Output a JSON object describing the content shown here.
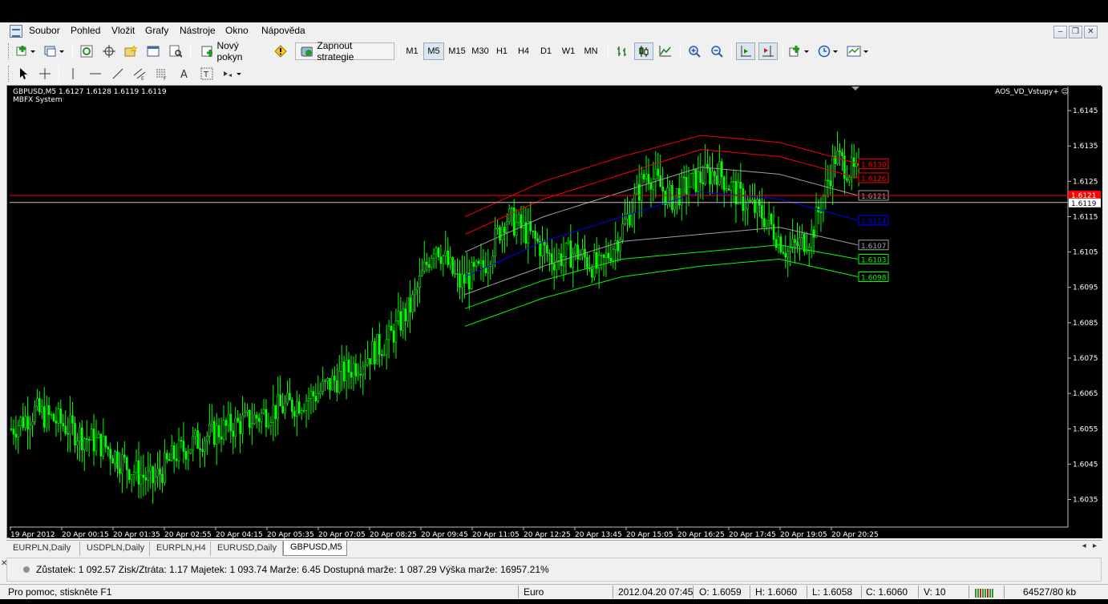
{
  "menu": [
    "Soubor",
    "Pohled",
    "Vložit",
    "Grafy",
    "Nástroje",
    "Okno",
    "Nápověda"
  ],
  "toolbar": {
    "new_order_label": "Nový pokyn",
    "strategy_label": "Zapnout strategie",
    "timeframes": [
      "M1",
      "M5",
      "M15",
      "M30",
      "H1",
      "H4",
      "D1",
      "W1",
      "MN"
    ],
    "active_timeframe": "M5"
  },
  "chart": {
    "symbol_info": "GBPUSD,M5  1.6127 1.6128 1.6119 1.6119",
    "indicator_name": "MBFX System",
    "expert_label": "AOS_VD_Vstupy+ ☺",
    "bid_label": "1.6119",
    "ask_label": "1.6121",
    "level_labels": [
      "1.6130",
      "1.6126",
      "1.6121",
      "1.6114",
      "1.6107",
      "1.6103",
      "1.6098"
    ],
    "colors": {
      "background": "#000000",
      "candles": "#00ff00",
      "upper_band": "#ff0000",
      "mid_band": "#0000ff",
      "neutral_band": "#a0a0a0",
      "lower_band": "#00ff00"
    }
  },
  "chart_data": {
    "type": "line",
    "title": "GBPUSD,M5",
    "xlabel": "",
    "ylabel": "",
    "y_ticks": [
      "1.6145",
      "1.6135",
      "1.6125",
      "1.6115",
      "1.6105",
      "1.6095",
      "1.6085",
      "1.6075",
      "1.6065",
      "1.6055",
      "1.6045",
      "1.6035"
    ],
    "ylim": [
      1.6029,
      1.615
    ],
    "x_ticks": [
      "19 Apr 2012",
      "20 Apr 00:15",
      "20 Apr 01:35",
      "20 Apr 02:55",
      "20 Apr 04:15",
      "20 Apr 05:35",
      "20 Apr 07:05",
      "20 Apr 08:25",
      "20 Apr 09:45",
      "20 Apr 11:05",
      "20 Apr 12:25",
      "20 Apr 13:45",
      "20 Apr 15:05",
      "20 Apr 16:25",
      "20 Apr 17:45",
      "20 Apr 19:05",
      "20 Apr 20:25"
    ],
    "series": [
      {
        "name": "GBPUSD",
        "values": [
          1.6055,
          1.606,
          1.6057,
          1.6053,
          1.605,
          1.6044,
          1.604,
          1.6048,
          1.6052,
          1.6055,
          1.6057,
          1.606,
          1.6062,
          1.6065,
          1.607,
          1.6075,
          1.608,
          1.609,
          1.6108,
          1.6096,
          1.61,
          1.6115,
          1.611,
          1.6103,
          1.6105,
          1.61,
          1.6112,
          1.6128,
          1.612,
          1.6125,
          1.6128,
          1.612,
          1.6115,
          1.6105,
          1.611,
          1.6132,
          1.6126
        ]
      }
    ],
    "bands": [
      {
        "label": "1.6130",
        "values": [
          1.6115,
          1.6125,
          1.6132,
          1.6138,
          1.6136,
          1.613
        ]
      },
      {
        "label": "1.6126",
        "values": [
          1.611,
          1.612,
          1.6127,
          1.6134,
          1.6132,
          1.6126
        ]
      },
      {
        "label": "1.6121",
        "values": [
          1.6105,
          1.6115,
          1.6122,
          1.6129,
          1.6127,
          1.6121
        ]
      },
      {
        "label": "1.6114",
        "values": [
          1.6098,
          1.6108,
          1.6115,
          1.6122,
          1.612,
          1.6114
        ]
      },
      {
        "label": "1.6107",
        "values": [
          1.6093,
          1.6101,
          1.6108,
          1.611,
          1.6112,
          1.6107
        ]
      },
      {
        "label": "1.6103",
        "values": [
          1.6089,
          1.6097,
          1.6103,
          1.6105,
          1.6107,
          1.6103
        ]
      },
      {
        "label": "1.6098",
        "values": [
          1.6084,
          1.6092,
          1.6098,
          1.6101,
          1.6103,
          1.6098
        ]
      }
    ],
    "grid": false
  },
  "tabs": [
    "EURPLN,Daily",
    "USDPLN,Daily",
    "EURPLN,H4",
    "EURUSD,Daily",
    "GBPUSD,M5"
  ],
  "active_tab": "GBPUSD,M5",
  "account_line": "Zůstatek: 1 092.57  Zisk/Ztráta: 1.17  Majetek: 1 093.74  Marže: 6.45  Dostupná marže: 1 087.29  Výška marže: 16957.21%",
  "status": {
    "help": "Pro pomoc, stiskněte F1",
    "profile": "Euro",
    "datetime": "2012.04.20 07:45",
    "open": "O: 1.6059",
    "high": "H: 1.6060",
    "low": "L: 1.6058",
    "close": "C: 1.6060",
    "volume": "V: 10",
    "traffic": "64527/80 kb"
  }
}
